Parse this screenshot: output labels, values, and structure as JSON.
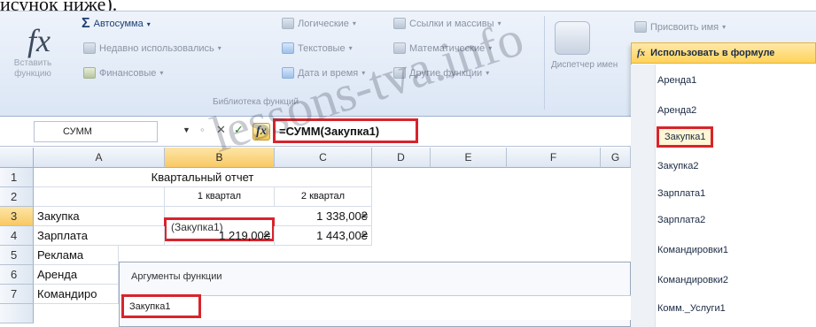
{
  "caption": "исунок ниже).",
  "ribbon": {
    "insert_function_label": "Вставить функцию",
    "autosum_label": "Автосумма",
    "recent_label": "Недавно использовались",
    "financial_label": "Финансовые",
    "logical_label": "Логические",
    "text_label": "Текстовые",
    "datetime_label": "Дата и время",
    "lookup_label": "Ссылки и массивы",
    "math_label": "Математические",
    "other_label": "Другие функции",
    "group_label": "Библиотека функций",
    "name_manager_label": "Диспетчер имен",
    "define_name_label": "Присвоить имя",
    "use_in_formula_label": "Использовать в формуле"
  },
  "names_menu": {
    "items": [
      "Аренда1",
      "Аренда2",
      "Закупка1",
      "Закупка2",
      "Зарплата1",
      "Зарплата2",
      "Командировки1",
      "Командировки2",
      "Комм._Услуги1"
    ],
    "selected": "Закупка1"
  },
  "formula_bar": {
    "name_box": "СУММ",
    "formula": "=СУММ(Закупка1)"
  },
  "grid": {
    "columns": [
      "A",
      "B",
      "C",
      "D",
      "E",
      "F",
      "G"
    ],
    "rows": [
      "1",
      "2",
      "3",
      "4",
      "5",
      "6",
      "7"
    ],
    "title": "Квартальный отчет",
    "b2": "1 квартал",
    "c2": "2 квартал",
    "a3": "Закупка",
    "b3": "(Закупка1)",
    "c3": "1 338,00₴",
    "a4": "Зарплата",
    "b4": "1 219,00₴",
    "c4": "1 443,00₴",
    "a5": "Реклама",
    "a6": "Аренда",
    "a7": "Командиро"
  },
  "dialog": {
    "title": "Аргументы функции",
    "field_value": "Закупка1"
  },
  "watermark": "lessons-tva.info",
  "colors": {
    "highlight_red": "#d8242c",
    "selection_gold": "#f8c964"
  }
}
